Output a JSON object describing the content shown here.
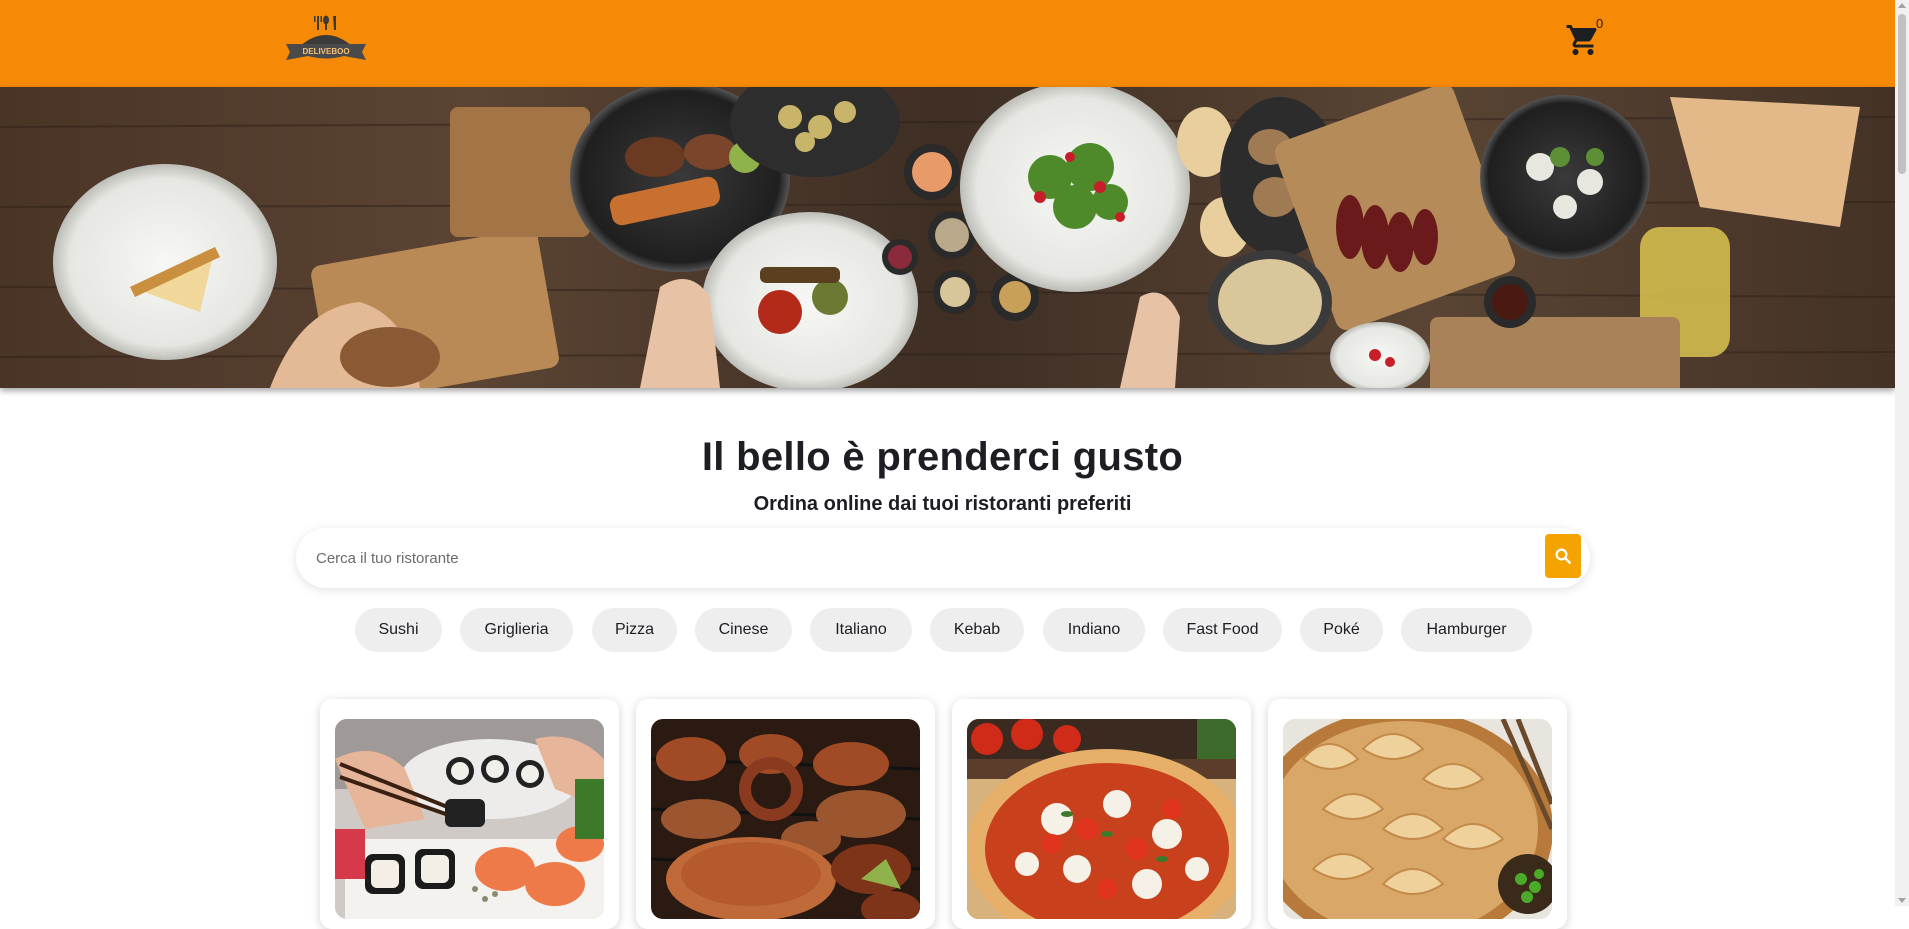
{
  "header": {
    "logo_text": "DELIVEBOO",
    "cart_count": "0",
    "colors": {
      "background": "#f68a06",
      "icon": "#1d1d24"
    }
  },
  "hero": {
    "image": "food-table-photo"
  },
  "main": {
    "headline": "Il bello è prenderci gusto",
    "subheadline": "Ordina online dai tuoi ristoranti preferiti"
  },
  "search": {
    "placeholder": "Cerca il tuo ristorante",
    "value": "",
    "button_icon": "search-icon",
    "button_color": "#f5a300"
  },
  "categories": [
    {
      "label": "Sushi"
    },
    {
      "label": "Griglieria"
    },
    {
      "label": "Pizza"
    },
    {
      "label": "Cinese"
    },
    {
      "label": "Italiano"
    },
    {
      "label": "Kebab"
    },
    {
      "label": "Indiano"
    },
    {
      "label": "Fast Food"
    },
    {
      "label": "Poké"
    },
    {
      "label": "Hamburger"
    }
  ],
  "cards": [
    {
      "image": "sushi-photo"
    },
    {
      "image": "grill-photo"
    },
    {
      "image": "pizza-photo"
    },
    {
      "image": "dumplings-photo"
    }
  ]
}
